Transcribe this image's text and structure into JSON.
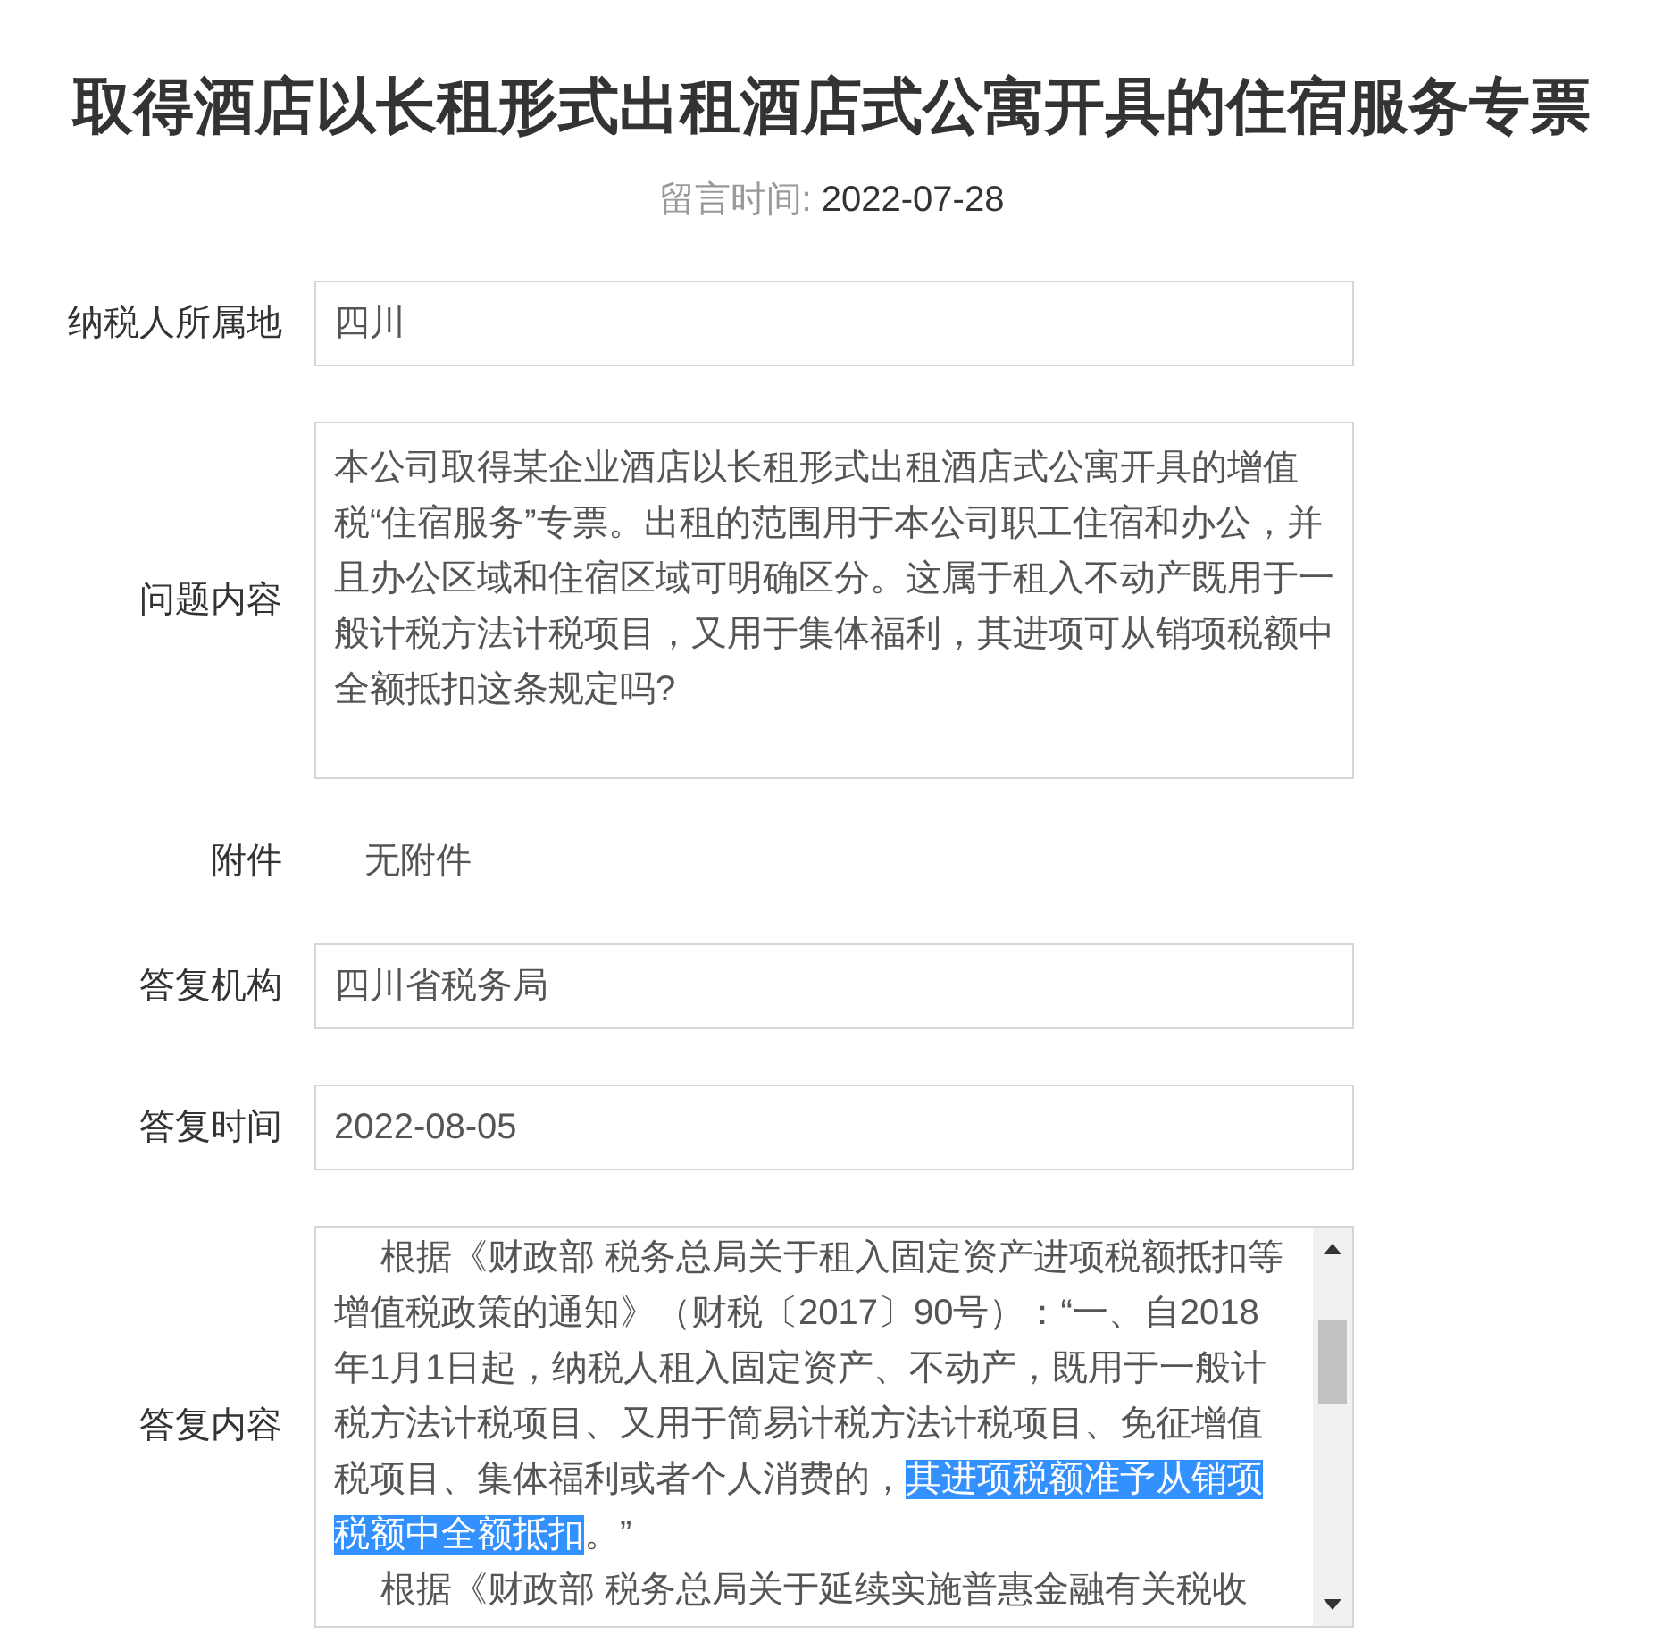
{
  "title": "取得酒店以长租形式出租酒店式公寓开具的住宿服务专票",
  "message_time": {
    "label": "留言时间:",
    "value": "2022-07-28"
  },
  "fields": [
    {
      "kind": "input",
      "label": "纳税人所属地",
      "value": "四川"
    },
    {
      "kind": "textarea",
      "label": "问题内容",
      "value": "本公司取得某企业酒店以长租形式出租酒店式公寓开具的增值税“住宿服务”专票。出租的范围用于本公司职工住宿和办公，并且办公区域和住宿区域可明确区分。这属于租入不动产既用于一般计税方法计税项目，又用于集体福利，其进项可从销项税额中全额抵扣这条规定吗?"
    },
    {
      "kind": "plain",
      "label": "附件",
      "value": "无附件"
    },
    {
      "kind": "input",
      "label": "答复机构",
      "value": "四川省税务局"
    },
    {
      "kind": "input",
      "label": "答复时间",
      "value": "2022-08-05"
    },
    {
      "kind": "scroll",
      "label": "答复内容",
      "paragraphs": [
        [
          {
            "text": "根据《财政部 税务总局关于租入固定资产进项税额抵扣等增值税政策的通知》（财税〔2017〕90号）：“一、自2018年1月1日起，纳税人租入固定资产、不动产，既用于一般计税方法计税项目、又用于简易计税方法计税项目、免征增值税项目、集体福利或者个人消费的，",
            "selected": false
          },
          {
            "text": "其进项税额准予从销项税额中全额抵扣",
            "selected": true
          },
          {
            "text": "。”",
            "selected": false
          }
        ],
        [
          {
            "text": "根据《财政部 税务总局关于延续实施普惠金融有关税收",
            "selected": false
          }
        ]
      ]
    }
  ]
}
